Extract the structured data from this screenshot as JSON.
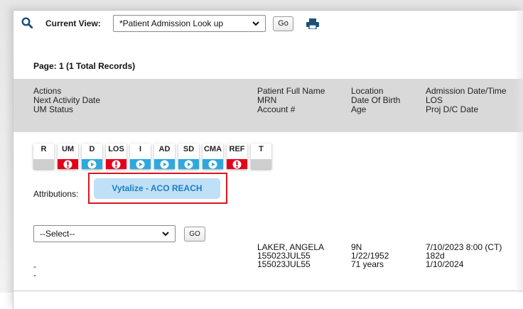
{
  "toolbar": {
    "current_view_label": "Current View:",
    "view_selected": "*Patient Admission Look up",
    "go_label": "Go"
  },
  "page_info": "Page:  1   (1 Total Records)",
  "columns": [
    {
      "lines": [
        "Actions",
        "Next Activity Date",
        "UM Status"
      ]
    },
    {
      "lines": [
        "Patient Full Name",
        "MRN",
        "Account #"
      ]
    },
    {
      "lines": [
        "Location",
        "Date Of Birth",
        "Age"
      ]
    },
    {
      "lines": [
        "Admission Date/Time",
        "LOS",
        "Proj D/C Date"
      ]
    }
  ],
  "action_tiles": [
    {
      "label": "R",
      "status": "gray"
    },
    {
      "label": "UM",
      "status": "red"
    },
    {
      "label": "D",
      "status": "blue"
    },
    {
      "label": "LOS",
      "status": "red"
    },
    {
      "label": "I",
      "status": "blue"
    },
    {
      "label": "AD",
      "status": "blue"
    },
    {
      "label": "SD",
      "status": "blue"
    },
    {
      "label": "CMA",
      "status": "blue"
    },
    {
      "label": "REF",
      "status": "red"
    },
    {
      "label": "T",
      "status": "gray"
    }
  ],
  "attributions": {
    "label": "Attributions:",
    "value": "Vytalize - ACO REACH"
  },
  "record": {
    "action_select": "--Select--",
    "go_label": "GO",
    "next_activity_date": "-",
    "um_status": "-",
    "patient_full_name": "LAKER, ANGELA",
    "mrn": "155023JUL55",
    "account": "155023JUL55",
    "location": "9N",
    "date_of_birth": "1/22/1952",
    "age": "71 years",
    "admission_datetime": "7/10/2023 8:00 (CT)",
    "los": "182d",
    "proj_dc_date": "1/10/2024"
  },
  "colors": {
    "accent_blue": "#1b7ec4",
    "status_red": "#e4001b",
    "status_blue": "#2ea8de",
    "highlight_red": "#d8171f",
    "pill_bg": "#bfe0f6"
  }
}
